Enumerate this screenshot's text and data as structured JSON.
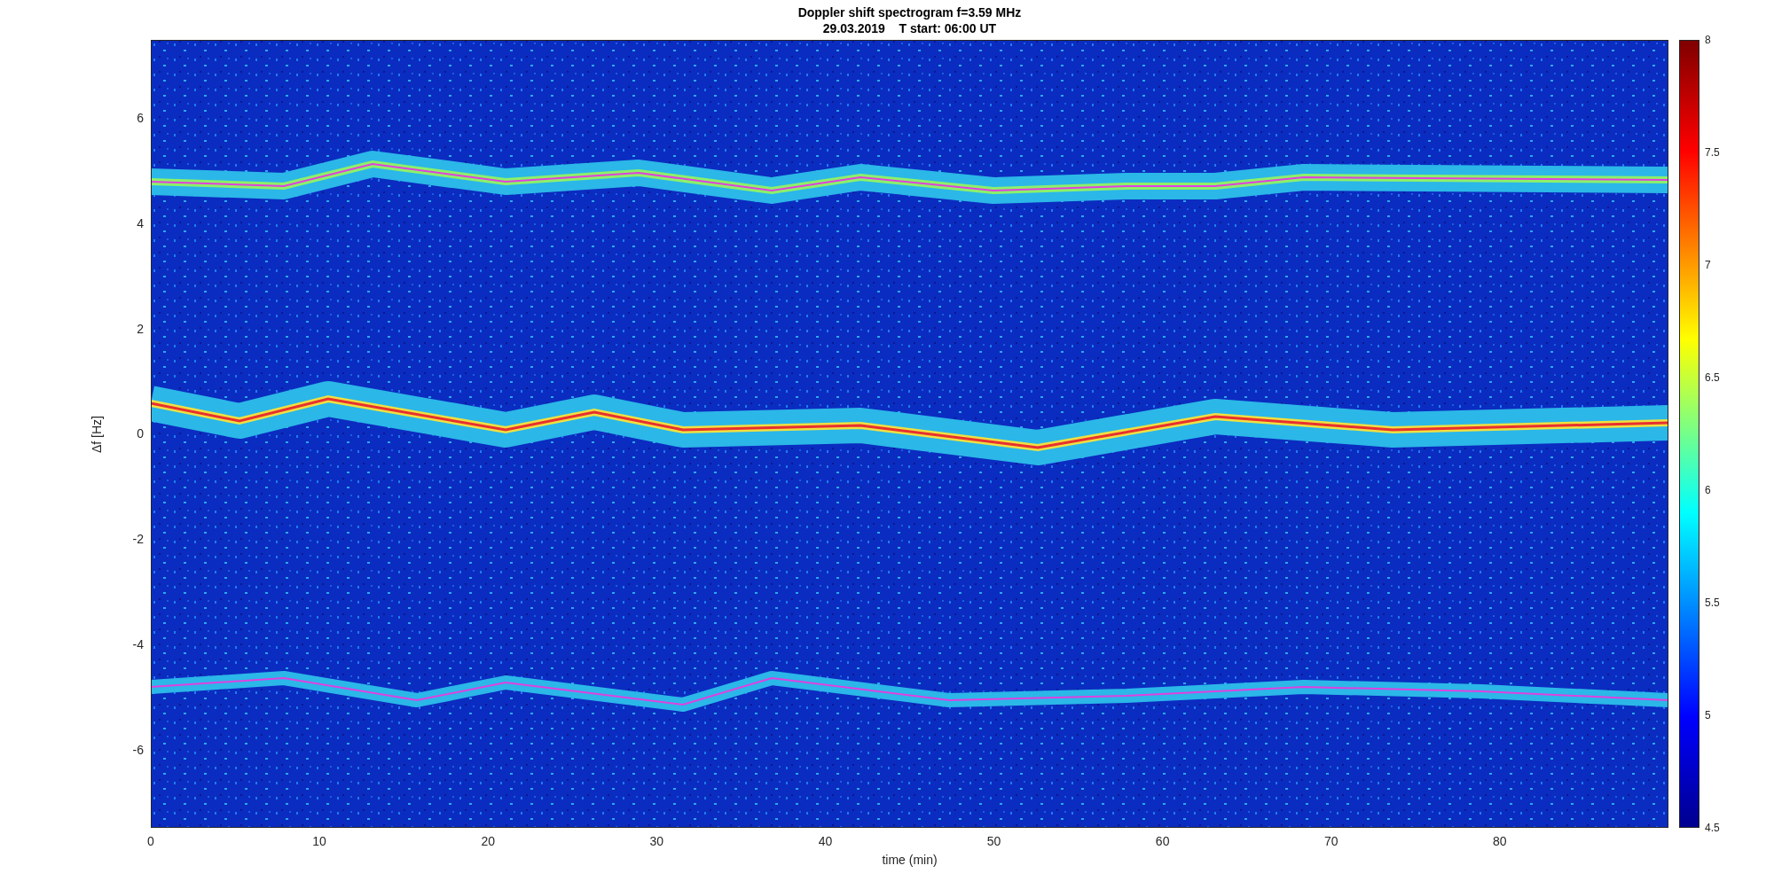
{
  "figure": {
    "title": [
      "Doppler shift spectrogram f=3.59 MHz",
      "29.03.2019    T start: 06:00 UT"
    ]
  },
  "axes": {
    "xlabel": "time (min)",
    "ylabel": "Δf [Hz]",
    "xticks": [
      "0",
      "10",
      "20",
      "30",
      "40",
      "50",
      "60",
      "70",
      "80"
    ],
    "yticks": [
      "6",
      "4",
      "2",
      "0",
      "-2",
      "-4",
      "-6"
    ]
  },
  "colorbar": {
    "ticks": [
      "8",
      "7.5",
      "7",
      "6.5",
      "6",
      "5.5",
      "5",
      "4.5"
    ]
  }
}
